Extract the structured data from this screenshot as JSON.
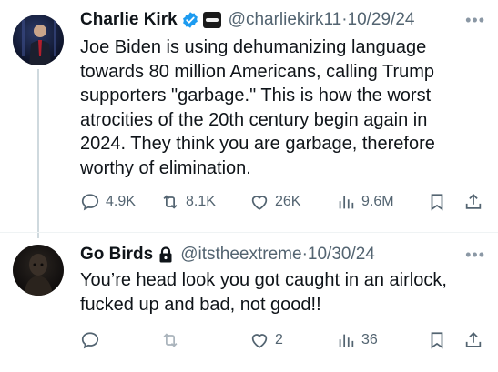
{
  "tweets": [
    {
      "display_name": "Charlie Kirk",
      "handle": "@charliekirk11",
      "separator": "·",
      "date": "10/29/24",
      "body_lines": [
        "Joe Biden is using dehumanizing language",
        "towards 80 million Americans, calling Trump",
        "supporters \"garbage.\" This is how the worst",
        "atrocities of the 20th century begin again in",
        "2024. They think you are garbage, therefore",
        "worthy of elimination."
      ],
      "replies": "4.9K",
      "reposts": "8.1K",
      "likes": "26K",
      "views": "9.6M"
    },
    {
      "display_name": "Go Birds",
      "handle": "@itstheextreme",
      "separator": "·",
      "date": "10/30/24",
      "body_lines": [
        "You’re head look you got caught in an airlock,",
        "fucked up and bad, not good!!"
      ],
      "replies": "",
      "reposts": "",
      "likes": "2",
      "views": "36"
    }
  ],
  "icons": {
    "more": "more-horizontal-icon",
    "reply": "reply-bubble-icon",
    "repost": "repost-arrows-icon",
    "like": "heart-icon",
    "views": "bar-chart-icon",
    "bookmark": "bookmark-icon",
    "share": "share-upload-icon",
    "verified": "verified-badge-icon",
    "lock": "lock-icon"
  },
  "colors": {
    "verified_blue": "#1d9bf0",
    "secondary_text": "#536471",
    "primary_text": "#0f1419"
  }
}
